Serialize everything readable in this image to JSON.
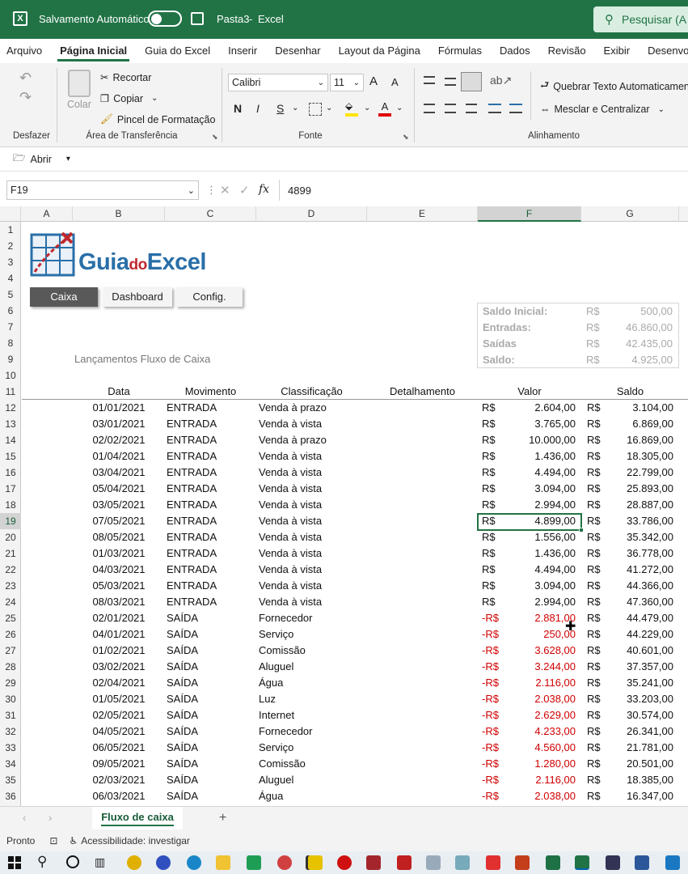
{
  "titlebar": {
    "autosave_label": "Salvamento Automático",
    "doc_title": "Pasta3",
    "sep": "-",
    "app_name": "Excel",
    "search_label": "Pesquisar (A"
  },
  "menu": [
    "Arquivo",
    "Página Inicial",
    "Guia do Excel",
    "Inserir",
    "Desenhar",
    "Layout da Página",
    "Fórmulas",
    "Dados",
    "Revisão",
    "Exibir",
    "Desenvolvedo"
  ],
  "ribbon": {
    "undo_group": "Desfazer",
    "paste_label": "Colar",
    "cut_label": "Recortar",
    "copy_label": "Copiar",
    "format_painter_label": "Pincel de Formatação",
    "clipboard_group": "Área de Transferência",
    "font_name": "Calibri",
    "font_size": "11",
    "grow_label": "A",
    "shrink_label": "A",
    "bold": "N",
    "italic": "I",
    "underline": "S",
    "font_group": "Fonte",
    "wrap_text": "Quebrar Texto Automaticamen",
    "merge_center": "Mesclar e Centralizar",
    "alignment_group": "Alinhamento"
  },
  "quickbar": {
    "open_label": "Abrir"
  },
  "formula": {
    "name_box": "F19",
    "fx": "fx",
    "value": "4899"
  },
  "columns": [
    "A",
    "B",
    "C",
    "D",
    "E",
    "F",
    "G"
  ],
  "rows": [
    "1",
    "2",
    "3",
    "4",
    "5",
    "6",
    "7",
    "8",
    "9",
    "10",
    "11",
    "12",
    "13",
    "14",
    "15",
    "16",
    "17",
    "18",
    "19",
    "20",
    "21",
    "22",
    "23",
    "24",
    "25",
    "26",
    "27",
    "28",
    "29",
    "30",
    "31",
    "32",
    "33",
    "34",
    "35",
    "36"
  ],
  "sheet": {
    "logo_text_a": "Guia",
    "logo_text_b": "do",
    "logo_text_c": "Excel",
    "nav_buttons": [
      "Caixa",
      "Dashboard",
      "Config."
    ],
    "section_title": "Lançamentos Fluxo de Caixa",
    "summary": [
      {
        "label": "Saldo Inicial:",
        "cur": "R$",
        "value": "500,00"
      },
      {
        "label": "Entradas:",
        "cur": "R$",
        "value": "46.860,00"
      },
      {
        "label": "Saídas",
        "cur": "R$",
        "value": "42.435,00"
      },
      {
        "label": "Saldo:",
        "cur": "R$",
        "value": "4.925,00"
      }
    ],
    "headers": [
      "Data",
      "Movimento",
      "Classificação",
      "Detalhamento",
      "Valor",
      "Saldo"
    ],
    "entries": [
      {
        "date": "01/01/2021",
        "mov": "ENTRADA",
        "cls": "Venda à prazo",
        "vcur": "R$",
        "val": "2.604,00",
        "scur": "R$",
        "bal": "3.104,00"
      },
      {
        "date": "03/01/2021",
        "mov": "ENTRADA",
        "cls": "Venda à vista",
        "vcur": "R$",
        "val": "3.765,00",
        "scur": "R$",
        "bal": "6.869,00"
      },
      {
        "date": "02/02/2021",
        "mov": "ENTRADA",
        "cls": "Venda à prazo",
        "vcur": "R$",
        "val": "10.000,00",
        "scur": "R$",
        "bal": "16.869,00"
      },
      {
        "date": "01/04/2021",
        "mov": "ENTRADA",
        "cls": "Venda à vista",
        "vcur": "R$",
        "val": "1.436,00",
        "scur": "R$",
        "bal": "18.305,00"
      },
      {
        "date": "03/04/2021",
        "mov": "ENTRADA",
        "cls": "Venda à vista",
        "vcur": "R$",
        "val": "4.494,00",
        "scur": "R$",
        "bal": "22.799,00"
      },
      {
        "date": "05/04/2021",
        "mov": "ENTRADA",
        "cls": "Venda à vista",
        "vcur": "R$",
        "val": "3.094,00",
        "scur": "R$",
        "bal": "25.893,00"
      },
      {
        "date": "03/05/2021",
        "mov": "ENTRADA",
        "cls": "Venda à vista",
        "vcur": "R$",
        "val": "2.994,00",
        "scur": "R$",
        "bal": "28.887,00"
      },
      {
        "date": "07/05/2021",
        "mov": "ENTRADA",
        "cls": "Venda à vista",
        "vcur": "R$",
        "val": "4.899,00",
        "scur": "R$",
        "bal": "33.786,00"
      },
      {
        "date": "08/05/2021",
        "mov": "ENTRADA",
        "cls": "Venda à vista",
        "vcur": "R$",
        "val": "1.556,00",
        "scur": "R$",
        "bal": "35.342,00"
      },
      {
        "date": "01/03/2021",
        "mov": "ENTRADA",
        "cls": "Venda à vista",
        "vcur": "R$",
        "val": "1.436,00",
        "scur": "R$",
        "bal": "36.778,00"
      },
      {
        "date": "04/03/2021",
        "mov": "ENTRADA",
        "cls": "Venda à vista",
        "vcur": "R$",
        "val": "4.494,00",
        "scur": "R$",
        "bal": "41.272,00"
      },
      {
        "date": "05/03/2021",
        "mov": "ENTRADA",
        "cls": "Venda à vista",
        "vcur": "R$",
        "val": "3.094,00",
        "scur": "R$",
        "bal": "44.366,00"
      },
      {
        "date": "08/03/2021",
        "mov": "ENTRADA",
        "cls": "Venda à vista",
        "vcur": "R$",
        "val": "2.994,00",
        "scur": "R$",
        "bal": "47.360,00"
      },
      {
        "date": "02/01/2021",
        "mov": "SAÍDA",
        "cls": "Fornecedor",
        "vcur": "-R$",
        "val": "2.881,00",
        "scur": "R$",
        "bal": "44.479,00"
      },
      {
        "date": "04/01/2021",
        "mov": "SAÍDA",
        "cls": "Serviço",
        "vcur": "-R$",
        "val": "250,00",
        "scur": "R$",
        "bal": "44.229,00"
      },
      {
        "date": "01/02/2021",
        "mov": "SAÍDA",
        "cls": "Comissão",
        "vcur": "-R$",
        "val": "3.628,00",
        "scur": "R$",
        "bal": "40.601,00"
      },
      {
        "date": "03/02/2021",
        "mov": "SAÍDA",
        "cls": "Aluguel",
        "vcur": "-R$",
        "val": "3.244,00",
        "scur": "R$",
        "bal": "37.357,00"
      },
      {
        "date": "02/04/2021",
        "mov": "SAÍDA",
        "cls": "Água",
        "vcur": "-R$",
        "val": "2.116,00",
        "scur": "R$",
        "bal": "35.241,00"
      },
      {
        "date": "01/05/2021",
        "mov": "SAÍDA",
        "cls": "Luz",
        "vcur": "-R$",
        "val": "2.038,00",
        "scur": "R$",
        "bal": "33.203,00"
      },
      {
        "date": "02/05/2021",
        "mov": "SAÍDA",
        "cls": "Internet",
        "vcur": "-R$",
        "val": "2.629,00",
        "scur": "R$",
        "bal": "30.574,00"
      },
      {
        "date": "04/05/2021",
        "mov": "SAÍDA",
        "cls": "Fornecedor",
        "vcur": "-R$",
        "val": "4.233,00",
        "scur": "R$",
        "bal": "26.341,00"
      },
      {
        "date": "06/05/2021",
        "mov": "SAÍDA",
        "cls": "Serviço",
        "vcur": "-R$",
        "val": "4.560,00",
        "scur": "R$",
        "bal": "21.781,00"
      },
      {
        "date": "09/05/2021",
        "mov": "SAÍDA",
        "cls": "Comissão",
        "vcur": "-R$",
        "val": "1.280,00",
        "scur": "R$",
        "bal": "20.501,00"
      },
      {
        "date": "02/03/2021",
        "mov": "SAÍDA",
        "cls": "Aluguel",
        "vcur": "-R$",
        "val": "2.116,00",
        "scur": "R$",
        "bal": "18.385,00"
      },
      {
        "date": "06/03/2021",
        "mov": "SAÍDA",
        "cls": "Água",
        "vcur": "-R$",
        "val": "2.038,00",
        "scur": "R$",
        "bal": "16.347,00"
      }
    ],
    "selected_cell": "F19"
  },
  "tabs": {
    "active": "Fluxo de caixa",
    "add": "+"
  },
  "status": {
    "ready": "Pronto",
    "accessibility": "Acessibilidade: investigar"
  },
  "colors": {
    "excel_green": "#217346",
    "negative": "#d00000",
    "logo_blue": "#2a6fa8"
  }
}
